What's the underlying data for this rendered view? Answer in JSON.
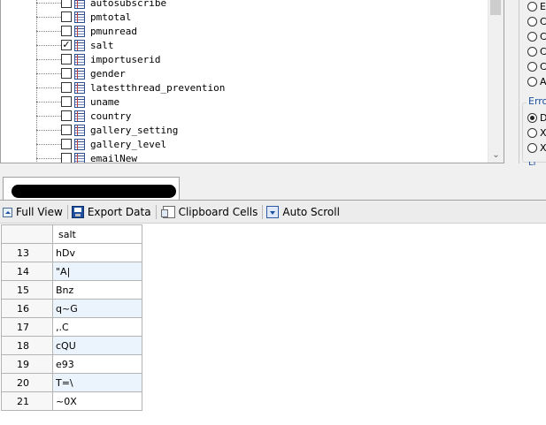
{
  "tree": {
    "items": [
      {
        "label": "autosubscribe",
        "checked": false
      },
      {
        "label": "pmtotal",
        "checked": false
      },
      {
        "label": "pmunread",
        "checked": false
      },
      {
        "label": "salt",
        "checked": true
      },
      {
        "label": "importuserid",
        "checked": false
      },
      {
        "label": "gender",
        "checked": false
      },
      {
        "label": "latestthread_prevention",
        "checked": false
      },
      {
        "label": "uname",
        "checked": false
      },
      {
        "label": "country",
        "checked": false
      },
      {
        "label": "gallery_setting",
        "checked": false
      },
      {
        "label": "gallery_level",
        "checked": false
      },
      {
        "label": "emailNew",
        "checked": false
      }
    ],
    "check_mark": "✓",
    "scroll_down_glyph": "⌄"
  },
  "options": {
    "radios": [
      {
        "label": "E",
        "checked": false
      },
      {
        "label": "C",
        "checked": false
      },
      {
        "label": "C",
        "checked": false
      },
      {
        "label": "C",
        "checked": false
      },
      {
        "label": "C",
        "checked": false
      },
      {
        "label": "A",
        "checked": false
      }
    ],
    "error_group_title": "Erro",
    "error_radios": [
      {
        "label": "D",
        "checked": true
      },
      {
        "label": "X",
        "checked": false
      },
      {
        "label": "X",
        "checked": false
      }
    ],
    "bottom_link": "Li"
  },
  "toolbar": {
    "full_view": "Full View",
    "export_data": "Export Data",
    "clipboard_cells": "Clipboard Cells",
    "auto_scroll": "Auto Scroll"
  },
  "grid": {
    "columns": [
      "salt"
    ],
    "rows": [
      {
        "num": "13",
        "salt": "hDv"
      },
      {
        "num": "14",
        "salt": "\"A|"
      },
      {
        "num": "15",
        "salt": "Bnz"
      },
      {
        "num": "16",
        "salt": "q~G"
      },
      {
        "num": "17",
        "salt": ",.C"
      },
      {
        "num": "18",
        "salt": "cQU"
      },
      {
        "num": "19",
        "salt": "e93"
      },
      {
        "num": "20",
        "salt": "T=\\"
      },
      {
        "num": "21",
        "salt": "~0X"
      }
    ]
  }
}
